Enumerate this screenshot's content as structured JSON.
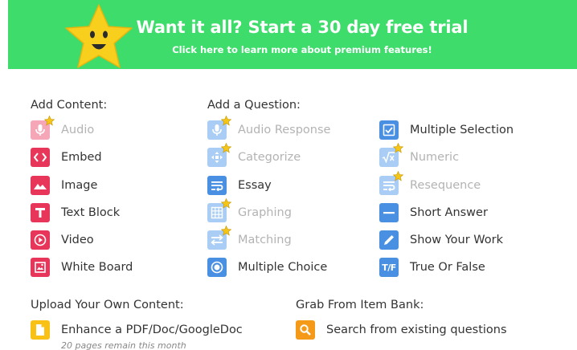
{
  "banner": {
    "title": "Want it all? Start a 30 day free trial",
    "subtitle": "Click here to learn more about premium features!",
    "color": "#3ddc6b",
    "mascot": "smiling-star-icon"
  },
  "add_content": {
    "heading": "Add Content:",
    "items": [
      {
        "label": "Audio",
        "icon": "microphone-icon",
        "premium": true
      },
      {
        "label": "Embed",
        "icon": "code-brackets-icon",
        "premium": false
      },
      {
        "label": "Image",
        "icon": "mountain-image-icon",
        "premium": false
      },
      {
        "label": "Text Block",
        "icon": "letter-t-icon",
        "premium": false
      },
      {
        "label": "Video",
        "icon": "play-circle-icon",
        "premium": false
      },
      {
        "label": "White Board",
        "icon": "whiteboard-icon",
        "premium": false
      }
    ]
  },
  "add_question": {
    "heading": "Add a Question:",
    "column1": [
      {
        "label": "Audio Response",
        "icon": "microphone-icon",
        "premium": true
      },
      {
        "label": "Categorize",
        "icon": "categorize-icon",
        "premium": true
      },
      {
        "label": "Essay",
        "icon": "text-wrap-icon",
        "premium": false
      },
      {
        "label": "Graphing",
        "icon": "grid-icon",
        "premium": true
      },
      {
        "label": "Matching",
        "icon": "swap-arrows-icon",
        "premium": true
      },
      {
        "label": "Multiple Choice",
        "icon": "radio-button-icon",
        "premium": false
      }
    ],
    "column2": [
      {
        "label": "Multiple Selection",
        "icon": "checkbox-icon",
        "premium": false
      },
      {
        "label": "Numeric",
        "icon": "square-root-icon",
        "premium": true
      },
      {
        "label": "Resequence",
        "icon": "resequence-icon",
        "premium": true
      },
      {
        "label": "Short Answer",
        "icon": "short-line-icon",
        "premium": false
      },
      {
        "label": "Show Your Work",
        "icon": "pencil-icon",
        "premium": false
      },
      {
        "label": "True Or False",
        "icon": "true-false-icon",
        "glyph": "T/F",
        "premium": false
      }
    ]
  },
  "upload": {
    "heading": "Upload Your Own Content:",
    "label": "Enhance a PDF/Doc/GoogleDoc",
    "icon": "document-icon",
    "note": "20 pages remain this month"
  },
  "item_bank": {
    "heading": "Grab From Item Bank:",
    "label": "Search from existing questions",
    "icon": "search-icon"
  },
  "colors": {
    "content_red": "#e8365b",
    "question_blue": "#4a90e2",
    "upload_yellow": "#f9c116",
    "bank_orange": "#f59a18",
    "premium_gold": "#f5c518"
  }
}
